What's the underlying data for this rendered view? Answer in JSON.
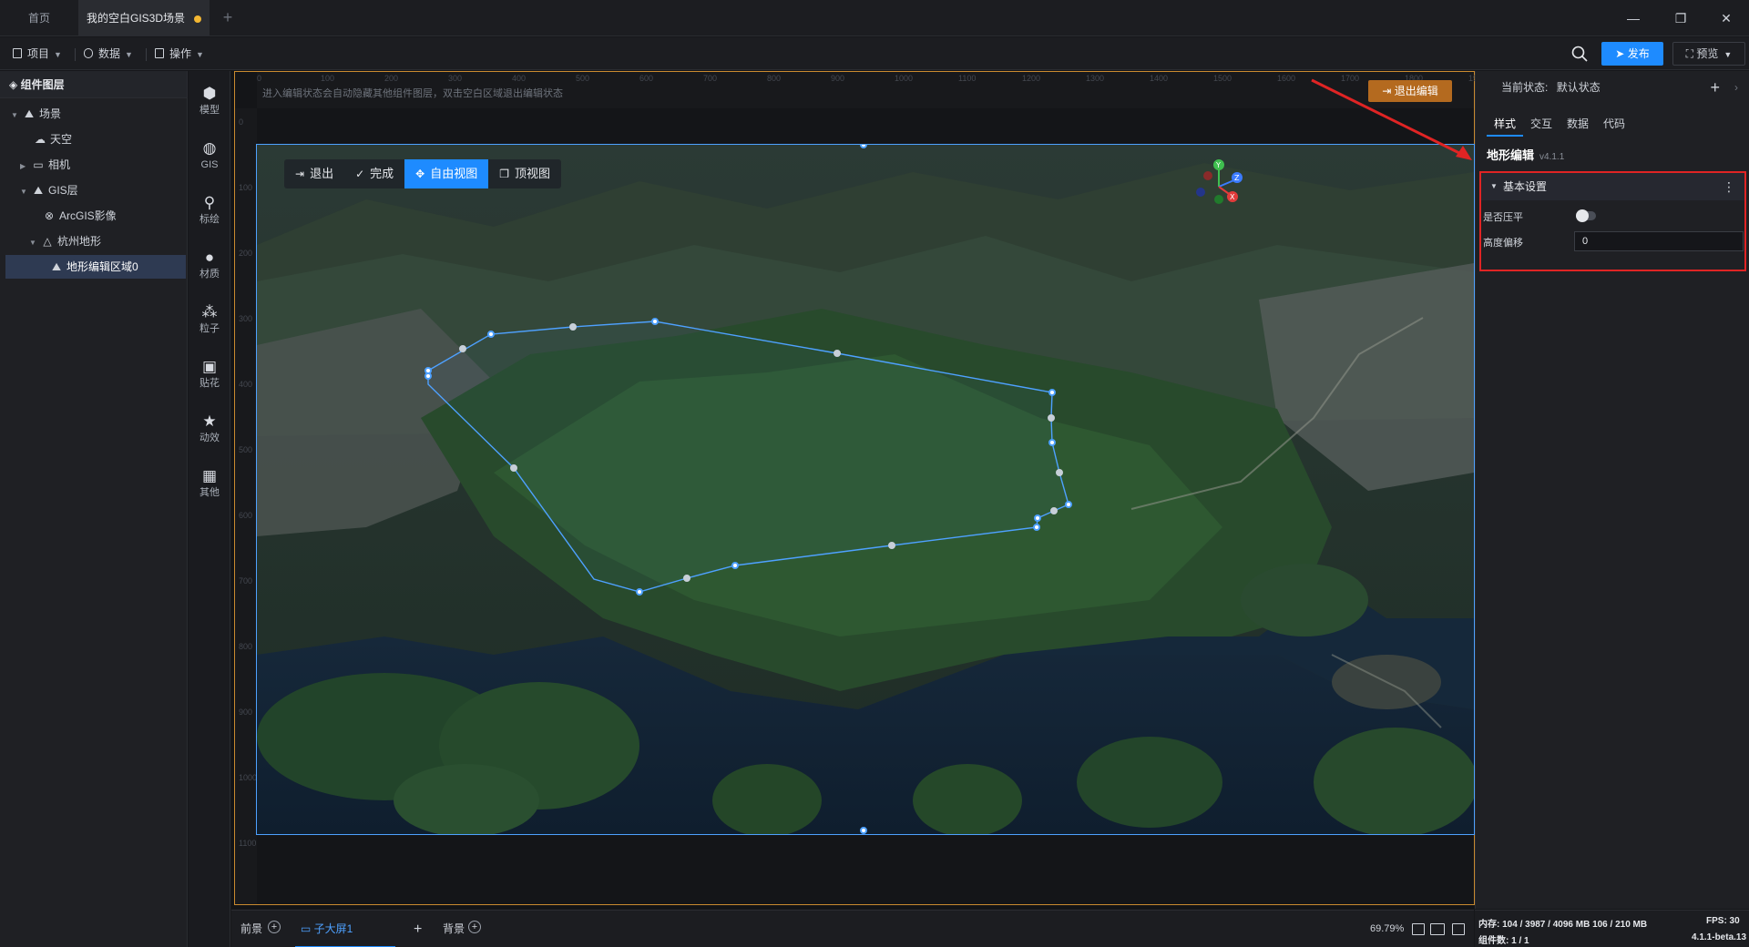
{
  "tabs": [
    {
      "label": "首页"
    },
    {
      "label": "我的空白GIS3D场景",
      "unsaved": true
    }
  ],
  "toolbar": {
    "menu_project": "项目",
    "menu_data": "数据",
    "menu_operate": "操作",
    "publish_label": "发布",
    "preview_label": "预览"
  },
  "layers": {
    "header": "组件图层",
    "items": [
      {
        "label": "场景",
        "icon": "scene-icon",
        "expanded": true
      },
      {
        "label": "天空",
        "icon": "sky-icon"
      },
      {
        "label": "相机",
        "icon": "folder-icon",
        "expanded": false
      },
      {
        "label": "GIS层",
        "icon": "gis-layer-icon",
        "expanded": true
      },
      {
        "label": "ArcGIS影像",
        "icon": "imagery-icon"
      },
      {
        "label": "杭州地形",
        "icon": "terrain-icon",
        "expanded": true
      },
      {
        "label": "地形编辑区域0",
        "icon": "region-icon",
        "selected": true
      }
    ]
  },
  "iconbar": [
    {
      "label": "模型",
      "icon": "model-icon"
    },
    {
      "label": "GIS",
      "icon": "globe-icon"
    },
    {
      "label": "标绘",
      "icon": "pin-icon"
    },
    {
      "label": "材质",
      "icon": "material-icon"
    },
    {
      "label": "粒子",
      "icon": "particle-icon"
    },
    {
      "label": "贴花",
      "icon": "decal-icon"
    },
    {
      "label": "动效",
      "icon": "effect-icon"
    },
    {
      "label": "其他",
      "icon": "grid-icon"
    }
  ],
  "canvas": {
    "hint": "进入编辑状态会自动隐藏其他组件图层，双击空白区域退出编辑状态",
    "exit_edit_label": "退出编辑",
    "scene_toolbar": {
      "exit": "退出",
      "done": "完成",
      "free_view": "自由视图",
      "top_view": "顶视图"
    },
    "gizmo": {
      "y": "Y",
      "z": "Z",
      "x": "X"
    }
  },
  "bottombar": {
    "foreground": "前景",
    "sub_screen": "子大屏1",
    "background": "背景",
    "zoom": "69.79%"
  },
  "rightpanel": {
    "state_label": "当前状态:",
    "state_value": "默认状态",
    "tabs": [
      "样式",
      "交互",
      "数据",
      "代码"
    ],
    "component_title": "地形编辑",
    "component_version": "v4.1.1",
    "section_title": "基本设置",
    "flatten_label": "是否压平",
    "flatten_value": false,
    "height_offset_label": "高度偏移",
    "height_offset_value": "0"
  },
  "status": {
    "memory": "内存:  104 / 3987 / 4096 MB  106 / 210 MB",
    "fps": "FPS:  30",
    "components": "组件数: 1 / 1",
    "version": "4.1.1-beta.13"
  },
  "colors": {
    "accent": "#1e8bff",
    "edit_border": "#c98a2f",
    "highlight_box": "#e02424",
    "polygon": "#4ea1ff"
  }
}
